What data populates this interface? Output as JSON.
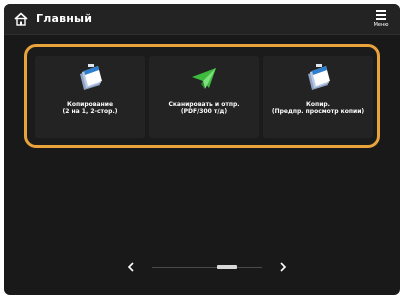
{
  "header": {
    "title": "Главный",
    "menu_label": "Меню"
  },
  "tiles": [
    {
      "label": "Копирование\n(2 на 1, 2-стор.)",
      "icon": "copy-icon"
    },
    {
      "label": "Сканировать и отпр.\n(PDF/300 т/д)",
      "icon": "scan-send-icon"
    },
    {
      "label": "Копир.\n(Предпр. просмотр копии)",
      "icon": "copy-preview-icon"
    }
  ],
  "pager": {
    "prev_icon": "chevron-left-icon",
    "next_icon": "chevron-right-icon",
    "current_page": 1,
    "total_pages": 2
  },
  "colors": {
    "background": "#191919",
    "header": "#232323",
    "tile": "#232323",
    "highlight_border": "#e8a33a",
    "text": "#ffffff"
  }
}
